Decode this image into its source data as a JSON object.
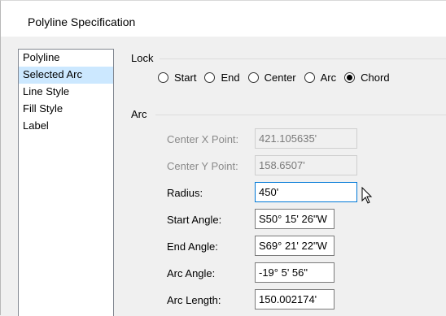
{
  "window": {
    "title": "Polyline Specification"
  },
  "sidebar": {
    "items": [
      {
        "label": "Polyline"
      },
      {
        "label": "Selected Arc",
        "selected": true
      },
      {
        "label": "Line Style"
      },
      {
        "label": "Fill Style"
      },
      {
        "label": "Label"
      }
    ]
  },
  "lock": {
    "group_label": "Lock",
    "options": [
      {
        "label": "Start",
        "checked": false
      },
      {
        "label": "End",
        "checked": false
      },
      {
        "label": "Center",
        "checked": false
      },
      {
        "label": "Arc",
        "checked": false
      },
      {
        "label": "Chord",
        "checked": true
      }
    ]
  },
  "arc": {
    "group_label": "Arc",
    "fields": {
      "center_x": {
        "label": "Center X Point:",
        "value": "421.105635'",
        "enabled": false
      },
      "center_y": {
        "label": "Center Y Point:",
        "value": "158.6507'",
        "enabled": false
      },
      "radius": {
        "label": "Radius:",
        "value": "450'",
        "enabled": true
      },
      "start_angle": {
        "label": "Start Angle:",
        "value": "S50° 15' 26\"W",
        "enabled": true
      },
      "end_angle": {
        "label": "End Angle:",
        "value": "S69° 21' 22\"W",
        "enabled": true
      },
      "arc_angle": {
        "label": "Arc Angle:",
        "value": "-19° 5' 56\"",
        "enabled": true
      },
      "arc_length": {
        "label": "Arc Length:",
        "value": "150.002174'",
        "enabled": true
      }
    }
  },
  "colors": {
    "selection": "#cce8ff",
    "focus_border": "#0078d7",
    "disabled_text": "#8a8a8a"
  }
}
